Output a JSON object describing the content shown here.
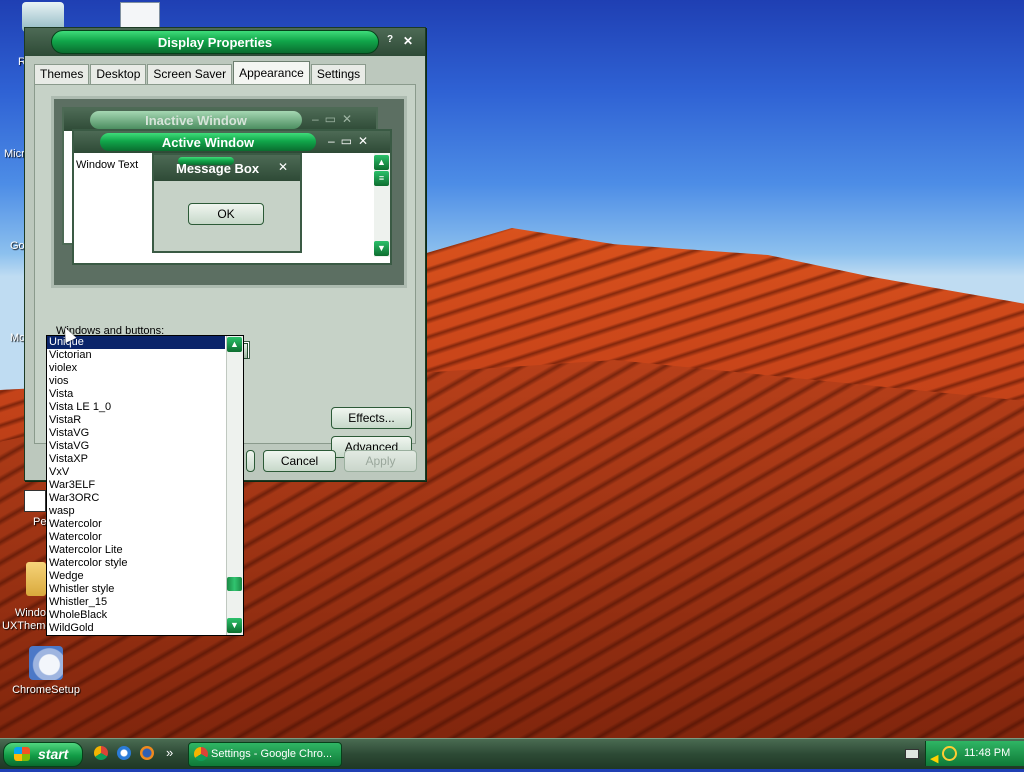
{
  "desktop": {
    "icons": [
      {
        "label": "ChromeSetup"
      },
      {
        "label": "Windo UXTheme"
      }
    ],
    "partial_labels": [
      "R",
      "Micr",
      "Go",
      "Mo",
      "Pe"
    ]
  },
  "dialog": {
    "title": "Display Properties",
    "help_btn": "?",
    "close_btn": "✕",
    "tabs": [
      "Themes",
      "Desktop",
      "Screen Saver",
      "Appearance",
      "Settings"
    ],
    "active_tab": "Appearance",
    "preview": {
      "inactive_title": "Inactive Window",
      "active_title": "Active Window",
      "window_text": "Window Text",
      "message_box_title": "Message Box",
      "ok_label": "OK"
    },
    "windows_buttons_label": "Windows and buttons:",
    "selected_style": "Unique",
    "effects_label": "Effects...",
    "advanced_label": "Advanced",
    "cancel_label": "Cancel",
    "apply_label": "Apply"
  },
  "dropdown": {
    "items": [
      "Unique",
      "Victorian",
      "violex",
      "vios",
      "Vista",
      "Vista LE 1_0",
      "VistaR",
      "VistaVG",
      "VistaVG",
      "VistaXP",
      "VxV",
      "War3ELF",
      "War3ORC",
      "wasp",
      "Watercolor",
      "Watercolor",
      "Watercolor Lite",
      "Watercolor style",
      "Wedge",
      "Whistler style",
      "Whistler_15",
      "WholeBlack",
      "WildGold"
    ],
    "selected_index": 0
  },
  "taskbar": {
    "start_label": "start",
    "task_label": "Settings - Google Chro...",
    "overflow": "»",
    "clock": "11:48 PM"
  },
  "colors": {
    "accent_green": "#11a64a",
    "selection": "#0a246a"
  }
}
